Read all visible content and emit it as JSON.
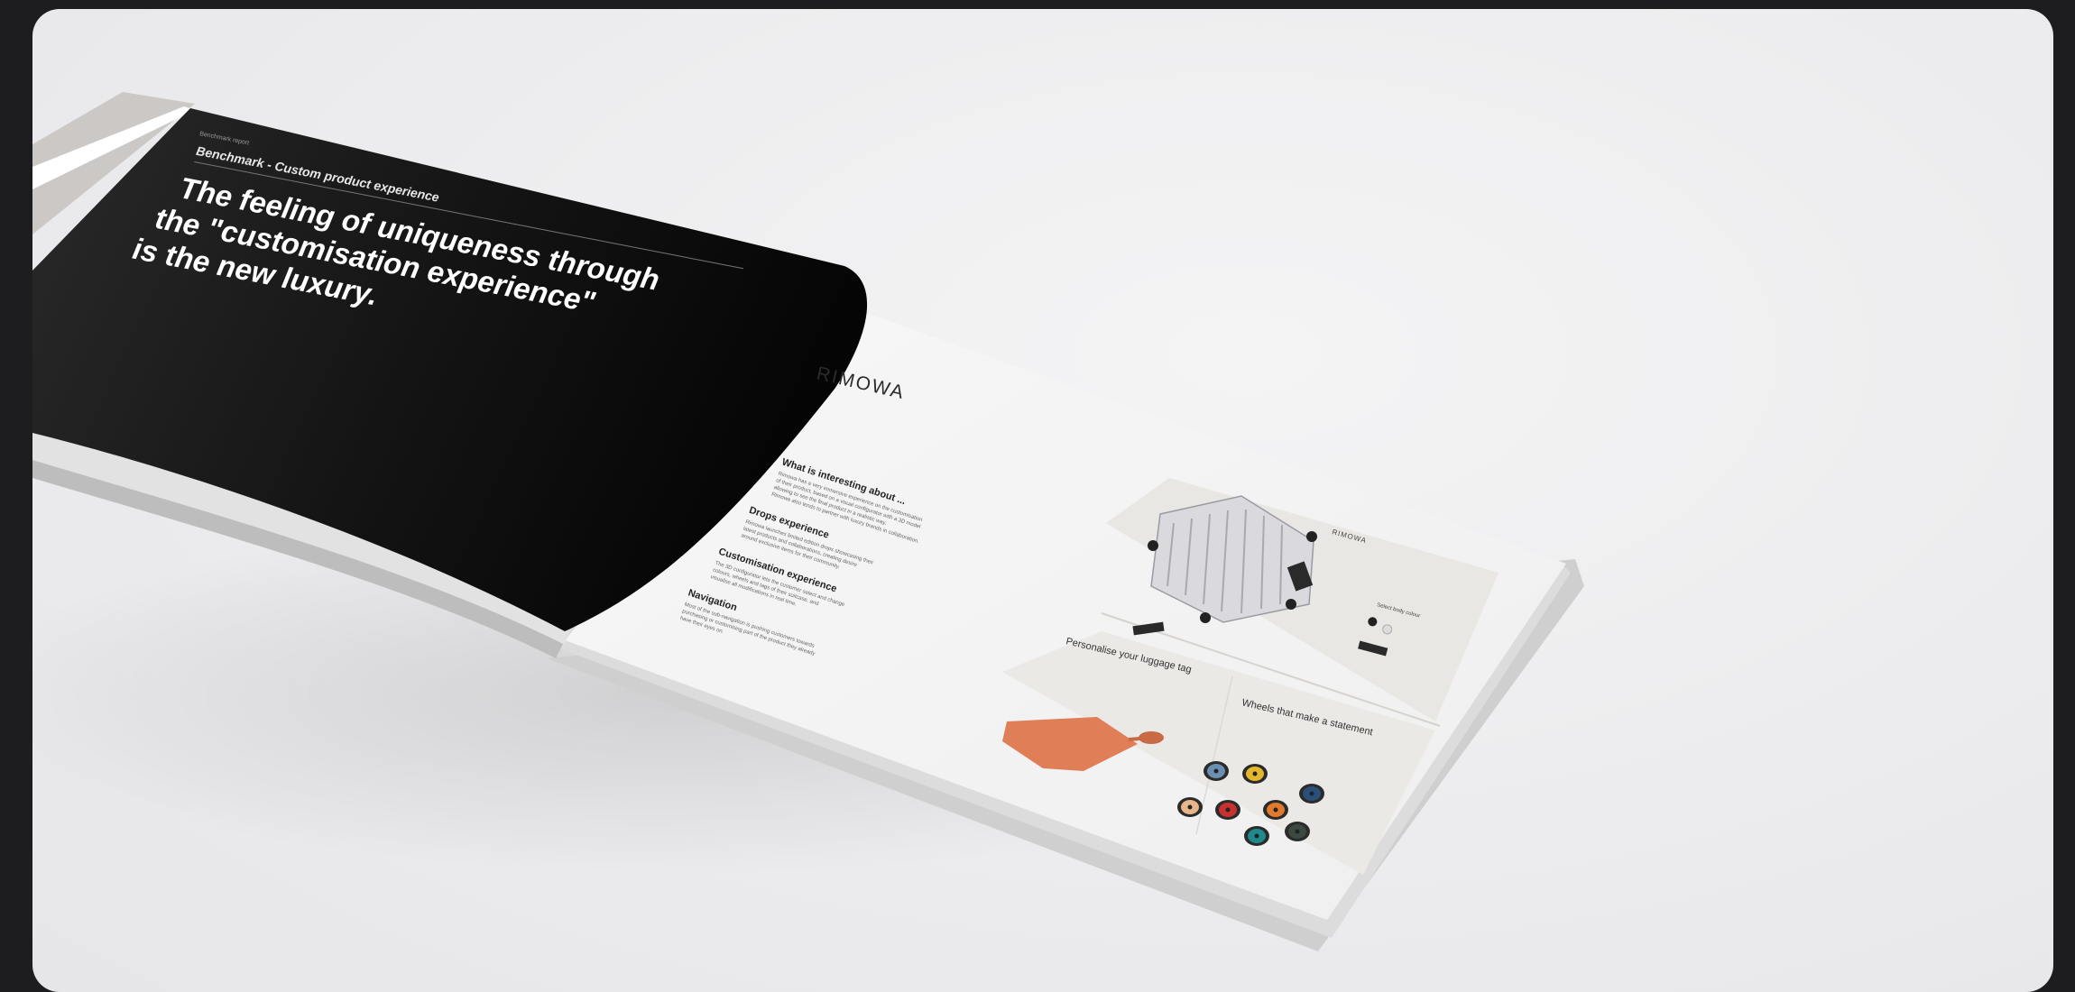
{
  "left_page": {
    "running_head": "Benchmark report",
    "section": "Benchmark - Custom product experience",
    "headline_lines": [
      "The feeling of uniqueness through",
      "the \"customisation experience\"",
      "is the new luxury."
    ]
  },
  "right_page": {
    "brand": "RIMOWA",
    "blocks": [
      {
        "heading": "What is interesting about ...",
        "body": [
          "Rimowa has a very immersive experience on the customisation",
          "of their product, based on a visual configurator with a 3D model",
          "allowing to see the final product in a realistic way.",
          "Rimowa also tends to partner with luxury brands in collaboration."
        ]
      },
      {
        "heading": "Drops experience",
        "body": [
          "Rimowa launches limited edition drops showcasing their",
          "latest products and collaborations, creating desire",
          "around exclusive items for their community."
        ]
      },
      {
        "heading": "Customisation experience",
        "body": [
          "The 3D configurator lets the customer select and change",
          "colours, wheels and tags of their suitcase, and",
          "visualise all modifications in real time."
        ]
      },
      {
        "heading": "Navigation",
        "body": [
          "Most of the sub-navigation is pushing customers towards",
          "purchasing or customising part of the product they already",
          "have their eyes on."
        ]
      }
    ],
    "screens": {
      "top_brand": "RIMOWA",
      "top_label": "Select body colour",
      "tag_title": "Personalise your luggage tag",
      "wheels_title": "Wheels that make a statement"
    },
    "wheel_colors": [
      "#6b8fb0",
      "#e3b62d",
      "#2a4f7a",
      "#e8b48a",
      "#c8322e",
      "#e07a2c",
      "#1f8a8c",
      "#3b4a3f"
    ],
    "tag_color": "#e07f57"
  }
}
